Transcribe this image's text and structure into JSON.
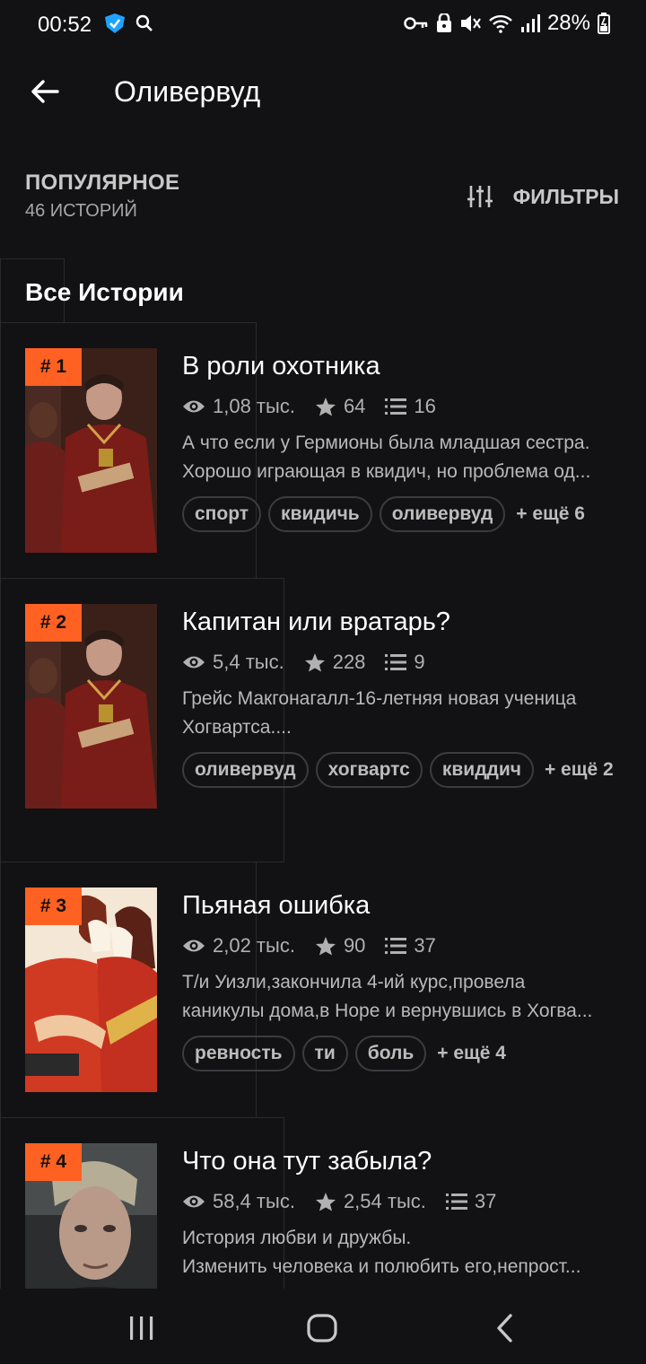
{
  "status_bar": {
    "time": "00:52",
    "battery": "28%"
  },
  "app_bar": {
    "title": "Оливервуд"
  },
  "section": {
    "title": "ПОПУЛЯРНОЕ",
    "count": "46 ИСТОРИЙ",
    "filters_label": "ФИЛЬТРЫ"
  },
  "list_header": "Все Истории",
  "stories": [
    {
      "rank": "# 1",
      "title": "В роли охотника",
      "views": "1,08 тыс.",
      "votes": "64",
      "parts": "16",
      "desc": [
        "А что если у Гермионы была младшая сестра.",
        "Хорошо играющая в квидич, но проблема од..."
      ],
      "tags": [
        "спорт",
        "квидичь",
        "оливервуд"
      ],
      "more": "+ ещё 6"
    },
    {
      "rank": "# 2",
      "title": "Капитан или вратарь?",
      "views": "5,4 тыс.",
      "votes": "228",
      "parts": "9",
      "desc": [
        "Грейс Макгонагалл-16-летняя новая ученица",
        "Хогвартса...."
      ],
      "tags": [
        "оливервуд",
        "хогвартс",
        "квиддич"
      ],
      "more": "+ ещё 2"
    },
    {
      "rank": "# 3",
      "title": "Пьяная ошибка",
      "views": "2,02 тыс.",
      "votes": "90",
      "parts": "37",
      "desc": [
        "Т/и Уизли,закончила 4-ий курс,провела",
        "каникулы дома,в Норе и вернувшись в Хогва..."
      ],
      "tags": [
        "ревность",
        "ти",
        "боль"
      ],
      "more": "+ ещё 4"
    },
    {
      "rank": "# 4",
      "title": "Что она тут забыла?",
      "views": "58,4 тыс.",
      "votes": "2,54 тыс.",
      "parts": "37",
      "desc": [
        "История любви и дружбы.",
        "Изменить человека и полюбить его,непрост..."
      ]
    }
  ],
  "icons": {
    "status_left": [
      "vpn-shield-icon",
      "search-icon"
    ],
    "status_right": [
      "key-icon",
      "lock-icon",
      "mute-icon",
      "wifi-icon",
      "signal-icon",
      "battery-icon"
    ],
    "back": "arrow-left-icon",
    "filters": "sliders-icon",
    "views": "eye-icon",
    "votes": "star-icon",
    "parts": "list-icon",
    "nav": [
      "recents-icon",
      "home-icon",
      "nav-back-icon"
    ]
  },
  "colors": {
    "background": "#121113",
    "rank_badge": "#ff6122",
    "tag_border": "#3c3b3e"
  }
}
